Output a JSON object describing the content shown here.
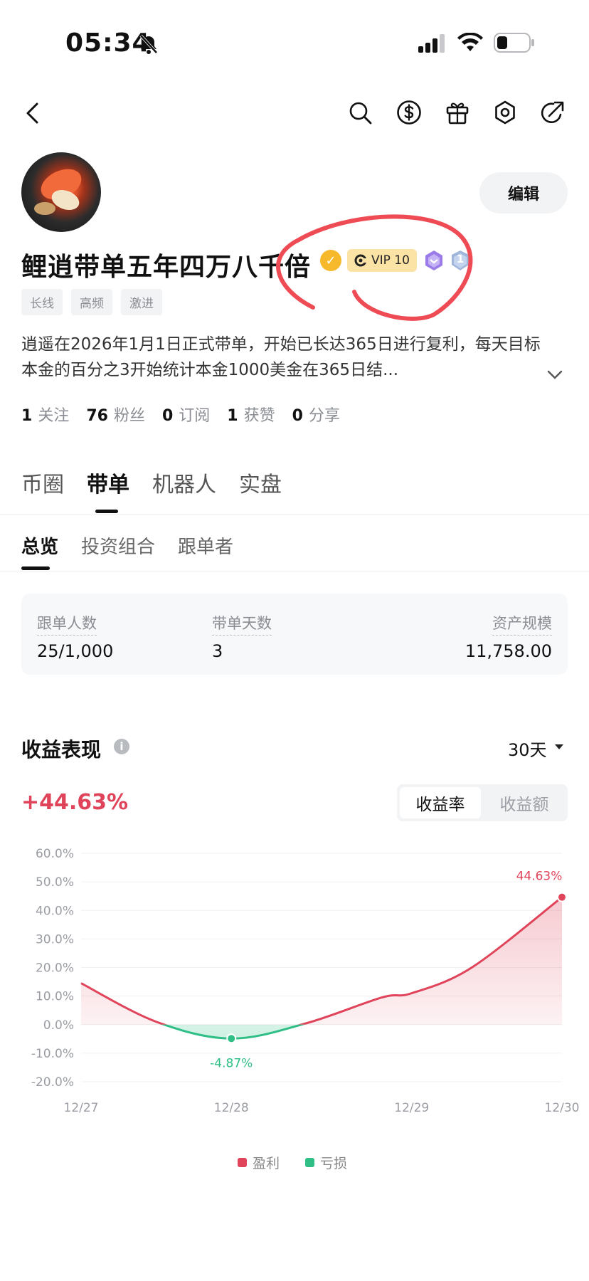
{
  "status_bar": {
    "time": "05:34"
  },
  "header": {
    "icons": [
      "back-icon",
      "search-icon",
      "dollar-icon",
      "gift-icon",
      "settings-icon",
      "share-icon"
    ]
  },
  "profile": {
    "edit_label": "编辑",
    "nickname": "鲤逍带单五年四万八千倍",
    "vip_label": "VIP 10",
    "level_badge": "1",
    "tags": [
      "长线",
      "高频",
      "激进"
    ],
    "bio": "逍遥在2026年1月1日正式带单，开始已长达365日进行复利，每天目标本金的百分之3开始统计本金1000美金在365日结...",
    "stats": [
      {
        "value": "1",
        "label": "关注"
      },
      {
        "value": "76",
        "label": "粉丝"
      },
      {
        "value": "0",
        "label": "订阅"
      },
      {
        "value": "1",
        "label": "获赞"
      },
      {
        "value": "0",
        "label": "分享"
      }
    ]
  },
  "tabs_main": [
    "币圈",
    "带单",
    "机器人",
    "实盘"
  ],
  "tabs_main_active": "带单",
  "tabs_sub": [
    "总览",
    "投资组合",
    "跟单者"
  ],
  "tabs_sub_active": "总览",
  "summary": [
    {
      "label": "跟单人数",
      "value": "25/1,000"
    },
    {
      "label": "带单天数",
      "value": "3"
    },
    {
      "label": "资产规模",
      "value": "11,758.00"
    }
  ],
  "performance": {
    "title": "收益表现",
    "info_icon": "i",
    "period": "30天",
    "value": "+44.63%",
    "toggle_on": "收益率",
    "toggle_off": "收益额"
  },
  "chart_data": {
    "type": "area",
    "x": [
      "12/27",
      "12/28",
      "12/29",
      "12/30"
    ],
    "x_positions_days": [
      0,
      1,
      2.2,
      3.2
    ],
    "curve": [
      [
        0,
        14.5
      ],
      [
        0.5,
        1.0
      ],
      [
        1.0,
        -4.87
      ],
      [
        1.5,
        0.5
      ],
      [
        2.0,
        9.5
      ],
      [
        2.2,
        11.0
      ],
      [
        2.6,
        20.0
      ],
      [
        3.2,
        44.63
      ]
    ],
    "y_ticks": [
      "60.0%",
      "50.0%",
      "40.0%",
      "30.0%",
      "20.0%",
      "10.0%",
      "0.0%",
      "-10.0%",
      "-20.0%"
    ],
    "ylim": [
      -20,
      60
    ],
    "annotations": [
      {
        "label": "44.63%",
        "x": 3.2,
        "y": 44.63,
        "kind": "profit"
      },
      {
        "label": "-4.87%",
        "x": 1.0,
        "y": -4.87,
        "kind": "loss"
      }
    ],
    "legend": [
      {
        "name": "盈利",
        "color": "#e0445a"
      },
      {
        "name": "亏损",
        "color": "#2fbf86"
      }
    ],
    "grid": true
  },
  "colors": {
    "profit": "#e0445a",
    "loss": "#2fbf86",
    "annotation": "#ee4b55"
  }
}
